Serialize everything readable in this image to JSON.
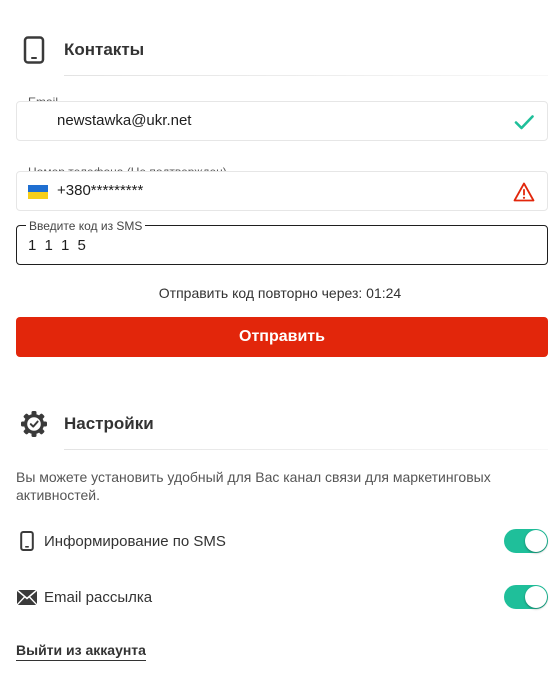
{
  "contacts": {
    "title": "Контакты",
    "icon": "phone-icon",
    "email": {
      "label": "Email",
      "value": "newstawka@ukr.net",
      "status_icon": "checkmark-icon",
      "status_color": "#1fbf9a"
    },
    "phone": {
      "label": "Номер телефона (Не подтвержден)",
      "value": "+380*********",
      "flag_icon": "ukraine-flag-icon",
      "status_icon": "warning-icon",
      "status_color": "#e2260b"
    },
    "sms_code": {
      "label": "Введите код из SMS",
      "value": "1 1 1 5"
    },
    "resend_text": "Отправить код повторно через: 01:24",
    "submit_label": "Отправить"
  },
  "settings": {
    "title": "Настройки",
    "icon": "gear-icon",
    "description": "Вы можете установить удобный для Вас канал связи для маркетинговых активностей.",
    "options": [
      {
        "label": "Информирование по SMS",
        "icon": "phone-icon",
        "enabled": true
      },
      {
        "label": "Email рассылка",
        "icon": "envelope-icon",
        "enabled": true
      }
    ]
  },
  "logout_label": "Выйти из аккаунта",
  "colors": {
    "accent": "#e2260b",
    "toggle_on": "#1fbf9a"
  }
}
